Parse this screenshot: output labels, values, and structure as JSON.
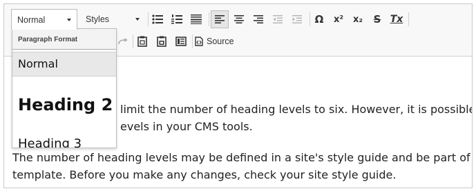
{
  "toolbar": {
    "format_combo": {
      "value": "Normal"
    },
    "styles_combo": {
      "value": "Styles"
    },
    "source_label": "Source",
    "symbols": {
      "omega": "Ω",
      "superscript": "x²",
      "subscript": "x₂",
      "strike": "S",
      "remove_format": "Tx"
    }
  },
  "dropdown": {
    "header": "Paragraph Format",
    "items": [
      {
        "label": "Normal",
        "selected": true
      },
      {
        "label": "Heading 2",
        "selected": false
      },
      {
        "label": "Heading 3",
        "selected": false
      }
    ]
  },
  "content": {
    "paragraph1": {
      "line1": "limit the number of heading levels to six. However, it is possible",
      "line2": "evels in your CMS tools."
    },
    "paragraph2": {
      "line1": "The number of heading levels may be defined in a site's style guide and be part of a",
      "line2": "template. Before you make any changes, check your site style guide."
    }
  },
  "colors": {
    "toolbar_bg": "#f8f8f8",
    "border": "#c9c9c9",
    "selected_item_bg": "#e8e8e8",
    "text": "#222222"
  }
}
